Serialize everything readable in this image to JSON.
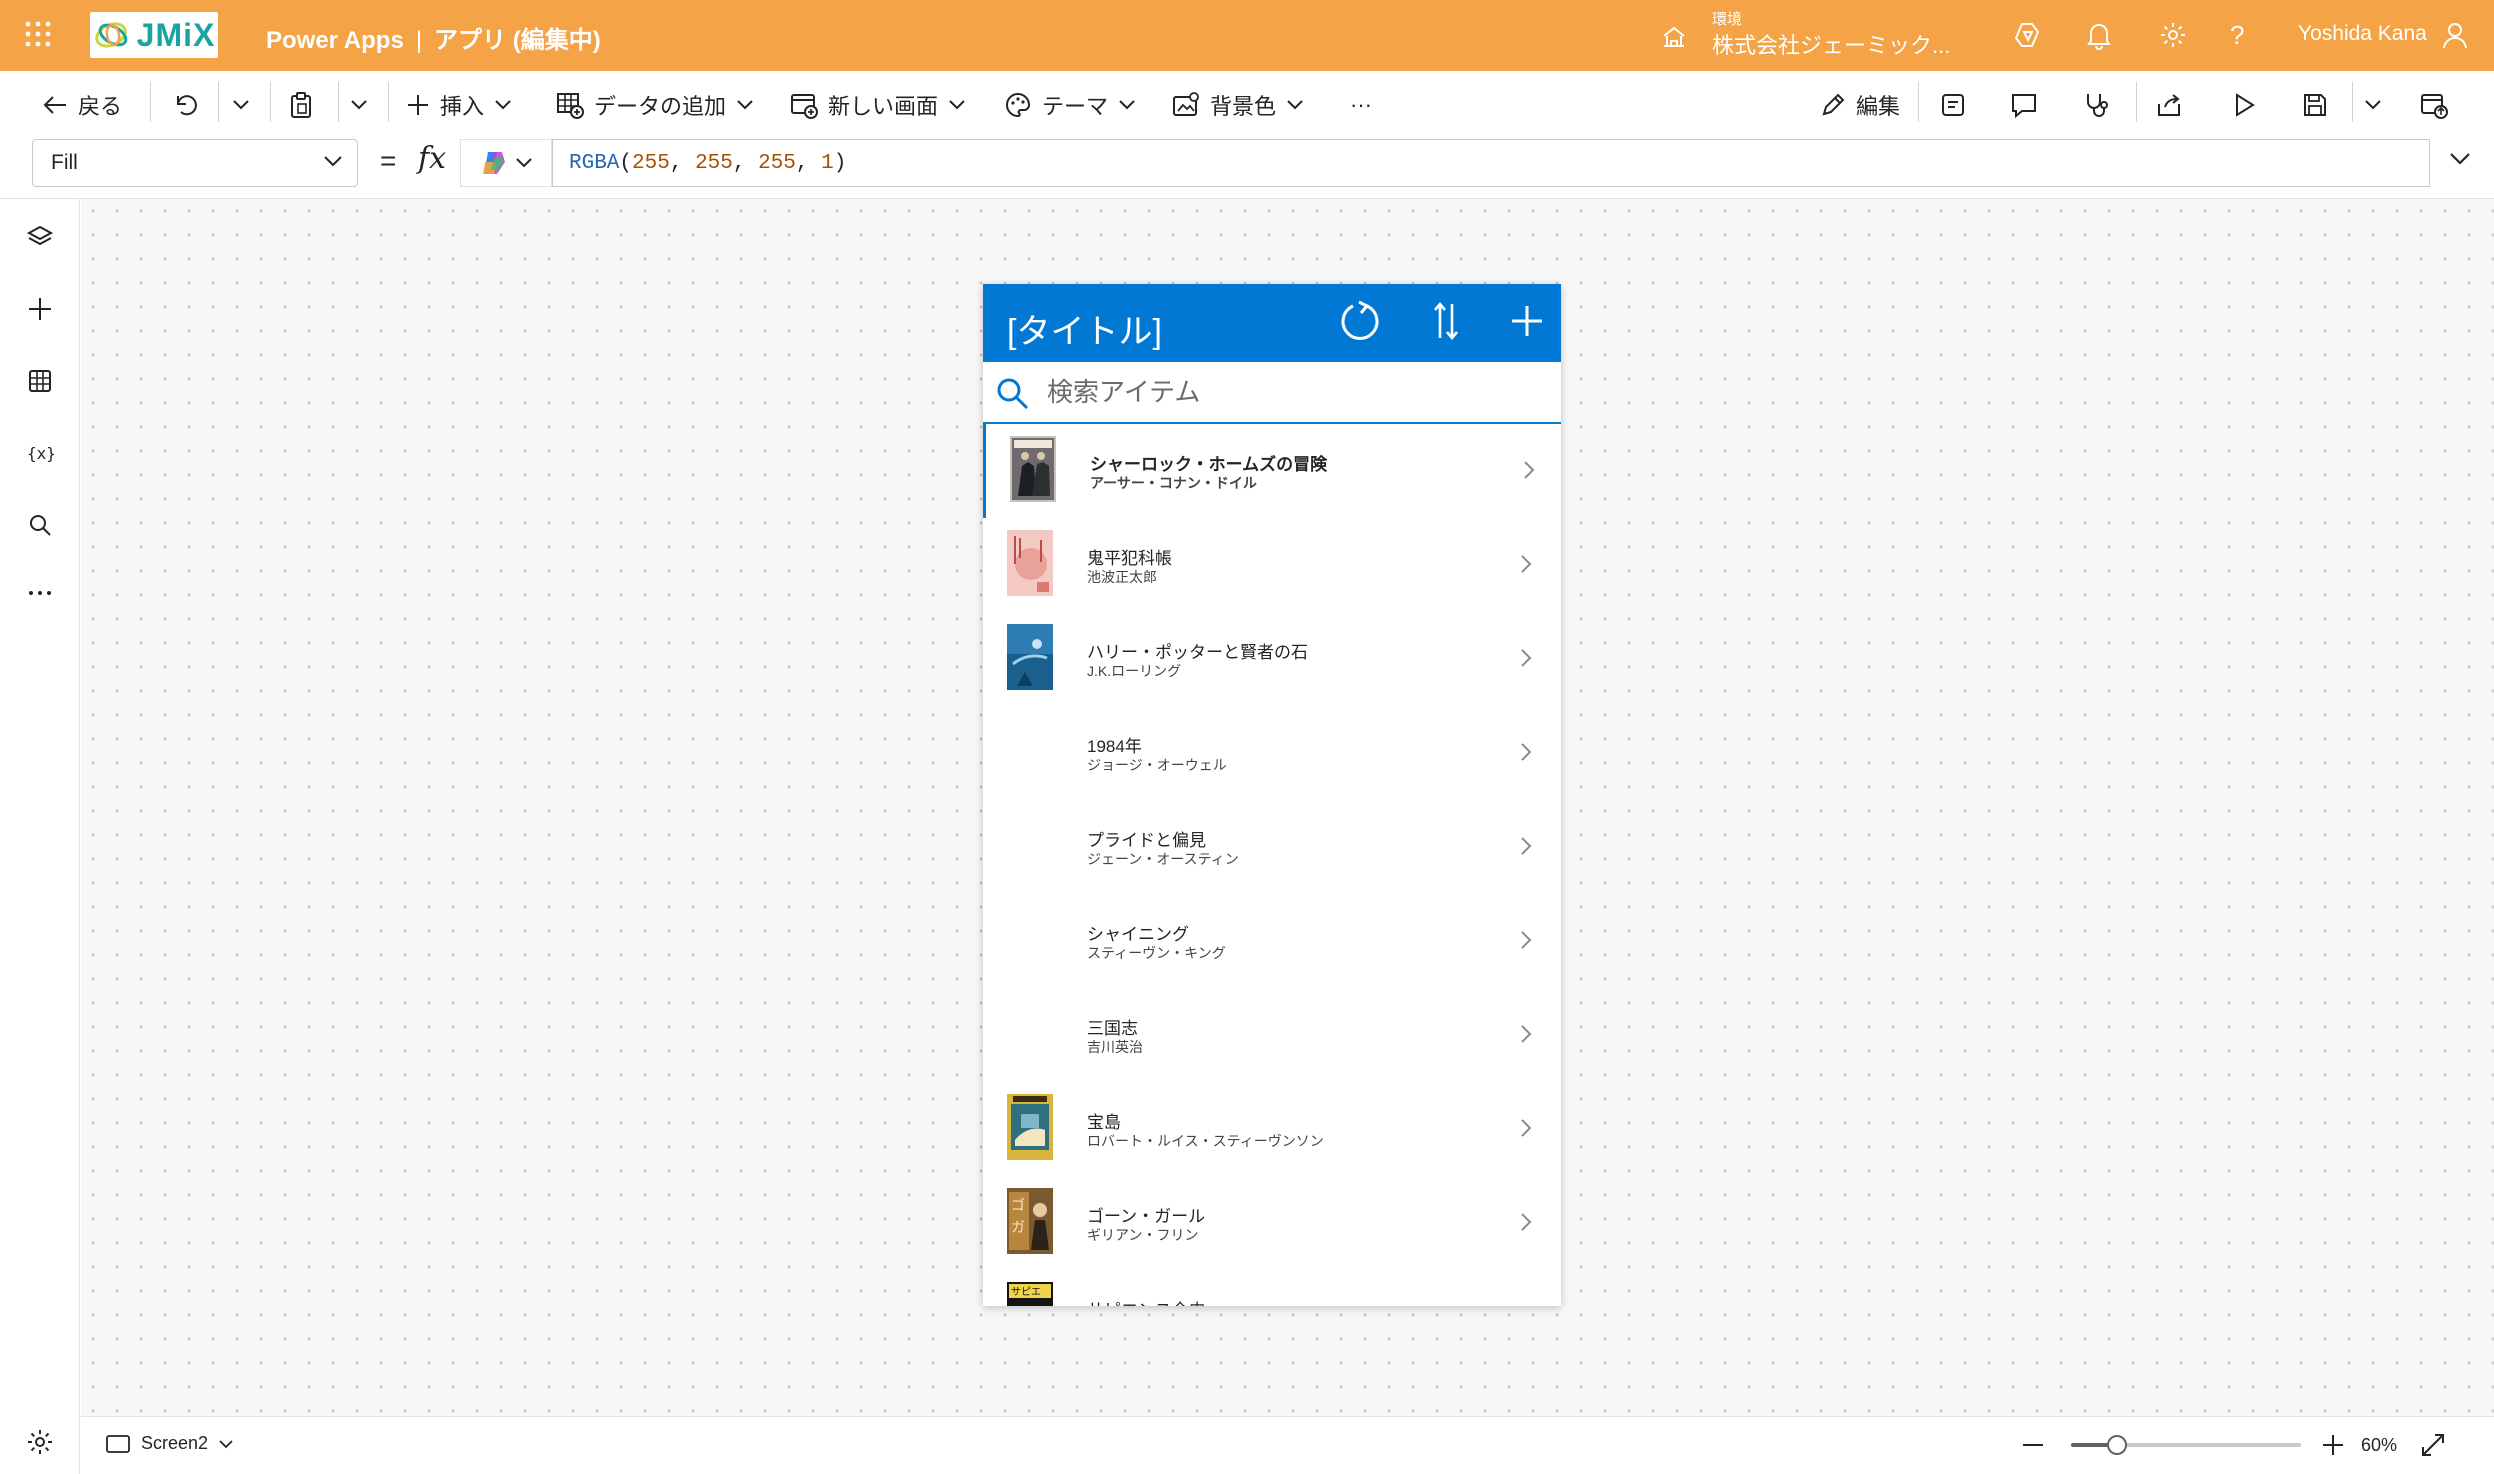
{
  "header": {
    "logo_text": "JMiX",
    "product": "Power Apps",
    "separator": "|",
    "app_name": "アプリ (編集中)",
    "environment_label": "環境",
    "environment_name": "株式会社ジェーミック...",
    "user_name": "Yoshida Kana",
    "background_color": "#f4a446"
  },
  "command_bar": {
    "back": "戻る",
    "insert": "挿入",
    "add_data": "データの追加",
    "new_screen": "新しい画面",
    "theme": "テーマ",
    "background_color": "背景色",
    "more": "···",
    "edit": "編集"
  },
  "formula_bar": {
    "property": "Fill",
    "equals": "=",
    "fx": "fx",
    "formula": {
      "fn": "RGBA",
      "open": "(",
      "r": "255",
      "g": "255",
      "b": "255",
      "a": "1",
      "comma": ", ",
      "close": ")"
    }
  },
  "left_rail": {
    "items": [
      "tree-view",
      "insert",
      "data",
      "variables",
      "search",
      "more"
    ]
  },
  "app_preview": {
    "title": "[タイトル]",
    "header_color": "#0078d4",
    "search_placeholder": "検索アイテム",
    "items": [
      {
        "title": "シャーロック・ホームズの冒険",
        "subtitle": "アーサー・コナン・ドイル",
        "selected": true,
        "cover": "holmes"
      },
      {
        "title": "鬼平犯科帳",
        "subtitle": "池波正太郎",
        "selected": false,
        "cover": "onihei"
      },
      {
        "title": "ハリー・ポッターと賢者の石",
        "subtitle": "J.K.ローリング",
        "selected": false,
        "cover": "harry"
      },
      {
        "title": "1984年",
        "subtitle": "ジョージ・オーウェル",
        "selected": false,
        "cover": ""
      },
      {
        "title": "プライドと偏見",
        "subtitle": "ジェーン・オースティン",
        "selected": false,
        "cover": ""
      },
      {
        "title": "シャイニング",
        "subtitle": "スティーヴン・キング",
        "selected": false,
        "cover": ""
      },
      {
        "title": "三国志",
        "subtitle": "吉川英治",
        "selected": false,
        "cover": ""
      },
      {
        "title": "宝島",
        "subtitle": "ロバート・ルイス・スティーヴンソン",
        "selected": false,
        "cover": "treasure"
      },
      {
        "title": "ゴーン・ガール",
        "subtitle": "ギリアン・フリン",
        "selected": false,
        "cover": "gone"
      },
      {
        "title": "サピエンス全史",
        "subtitle": "",
        "selected": false,
        "cover": "sapiens"
      }
    ]
  },
  "bottom_bar": {
    "screen_name": "Screen2",
    "zoom_level": "60%",
    "zoom_fraction": 0.2
  }
}
